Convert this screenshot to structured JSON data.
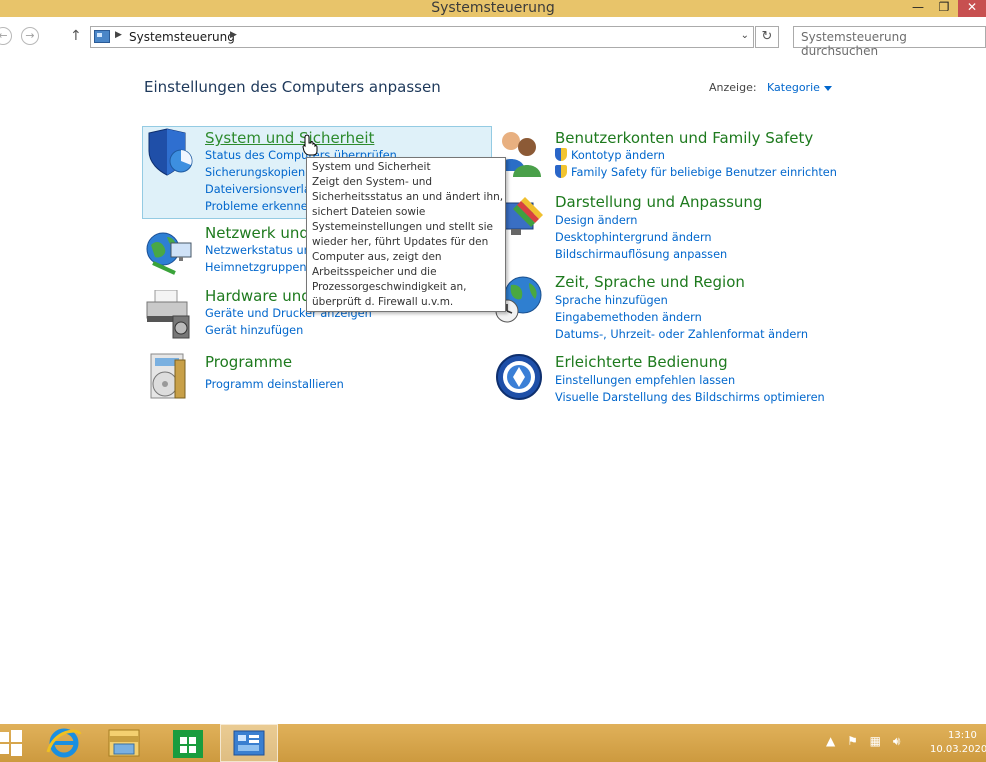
{
  "window": {
    "title": "Systemsteuerung",
    "buttons": {
      "minimize": "—",
      "maximize": "❐",
      "close": "✕"
    }
  },
  "address": {
    "breadcrumb": "Systemsteuerung",
    "search_placeholder": "Systemsteuerung durchsuchen"
  },
  "header": {
    "title": "Einstellungen des Computers anpassen",
    "view_label": "Anzeige:",
    "view_value": "Kategorie"
  },
  "categories": {
    "system": {
      "title": "System und Sicherheit",
      "links": [
        "Status des Computers überprüfen",
        "Sicherungskopien v",
        "Dateiversionsverlau",
        "Probleme erkennen"
      ],
      "icon": "shield-icon"
    },
    "network": {
      "title": "Netzwerk und",
      "links": [
        "Netzwerkstatus und",
        "Heimnetzgruppen-"
      ],
      "icon": "network-icon"
    },
    "hardware": {
      "title": "Hardware und",
      "links": [
        "Geräte und Drucker anzeigen",
        "Gerät hinzufügen"
      ],
      "icon": "printer-icon"
    },
    "programs": {
      "title": "Programme",
      "links": [
        "Programm deinstallieren"
      ],
      "icon": "programs-icon"
    },
    "users": {
      "title": "Benutzerkonten und Family Safety",
      "links": [
        "Kontotyp ändern",
        "Family Safety für beliebige Benutzer einrichten"
      ],
      "icon": "users-icon"
    },
    "appearance": {
      "title": "Darstellung und Anpassung",
      "links": [
        "Design ändern",
        "Desktophintergrund ändern",
        "Bildschirmauflösung anpassen"
      ],
      "icon": "appearance-icon"
    },
    "region": {
      "title": "Zeit, Sprache und Region",
      "links": [
        "Sprache hinzufügen",
        "Eingabemethoden ändern",
        "Datums-, Uhrzeit- oder Zahlenformat ändern"
      ],
      "icon": "globe-clock-icon"
    },
    "access": {
      "title": "Erleichterte Bedienung",
      "links": [
        "Einstellungen empfehlen lassen",
        "Visuelle Darstellung des Bildschirms optimieren"
      ],
      "icon": "accessibility-icon"
    }
  },
  "tooltip": {
    "lines": [
      "System und Sicherheit",
      "Zeigt den System- und",
      "Sicherheitsstatus an und ändert ihn,",
      "sichert Dateien sowie",
      "Systemeinstellungen und stellt sie",
      "wieder her, führt Updates für den",
      "Computer aus, zeigt den",
      "Arbeitsspeicher und die",
      "Prozessorgeschwindigkeit an,",
      "überprüft d. Firewall u.v.m."
    ]
  },
  "taskbar": {
    "time": "13:10",
    "date": "10.03.2020"
  },
  "colors": {
    "titlebar": "#e8c46a",
    "taskbar": "#d9a84d",
    "category_heading": "#1e7a1e",
    "link": "#0066cc",
    "selection_bg": "#dff1f9"
  }
}
